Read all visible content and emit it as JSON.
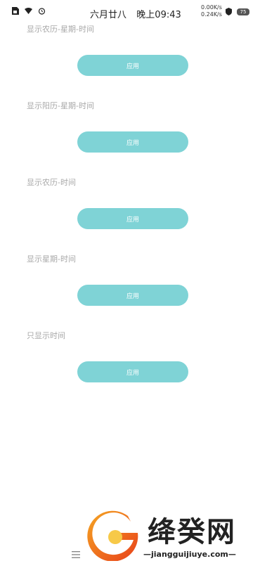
{
  "status_bar": {
    "date": "六月廿八",
    "time": "晚上09:43",
    "upload_speed": "0.00K/s",
    "download_speed": "0.24K/s",
    "battery_level": "75"
  },
  "options": [
    {
      "label": "显示农历-星期-时间",
      "button_label": "应用"
    },
    {
      "label": "显示阳历-星期-时间",
      "button_label": "应用"
    },
    {
      "label": "显示农历-时间",
      "button_label": "应用"
    },
    {
      "label": "显示星期-时间",
      "button_label": "应用"
    },
    {
      "label": "只显示时间",
      "button_label": "应用"
    }
  ],
  "colors": {
    "button_bg": "#7fd3d6",
    "label_text": "#a8a8a8"
  },
  "watermark": {
    "brand": "绛癸网",
    "url": "—jiangguijiuye.com—"
  }
}
